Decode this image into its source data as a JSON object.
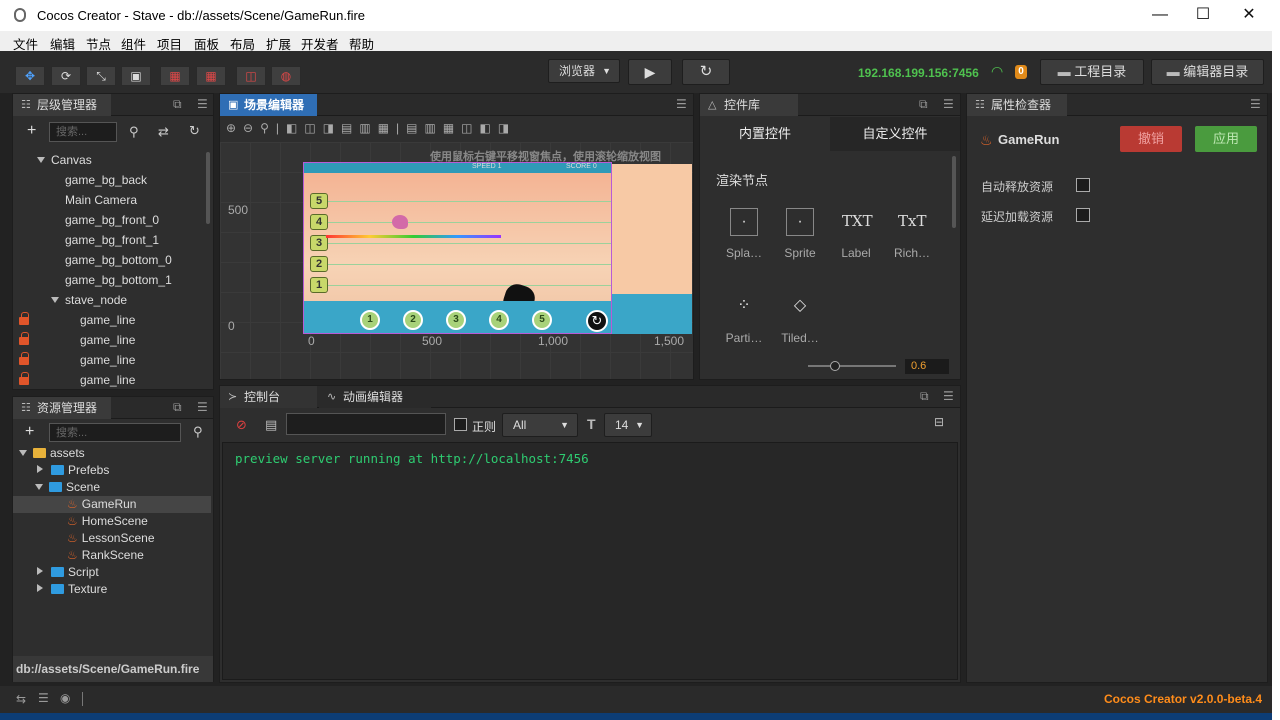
{
  "window": {
    "title": "Cocos Creator - Stave - db://assets/Scene/GameRun.fire",
    "minimize": "—",
    "maximize": "☐",
    "close": "✕"
  },
  "menu": [
    "文件",
    "编辑",
    "节点",
    "组件",
    "项目",
    "面板",
    "布局",
    "扩展",
    "开发者",
    "帮助"
  ],
  "toolbar": {
    "browser_select": "浏览器",
    "play_icon": "▶",
    "refresh_icon": "↻",
    "ip": "192.168.199.156:7456",
    "wifi_badge": "0",
    "project_dir": "工程目录",
    "editor_dir": "编辑器目录"
  },
  "hierarchy": {
    "title": "层级管理器",
    "search_placeholder": "搜索...",
    "items": [
      {
        "label": "Canvas",
        "depth": 0,
        "expanded": true,
        "lock": false
      },
      {
        "label": "game_bg_back",
        "depth": 1,
        "lock": false
      },
      {
        "label": "Main Camera",
        "depth": 1,
        "lock": false
      },
      {
        "label": "game_bg_front_0",
        "depth": 1,
        "lock": false
      },
      {
        "label": "game_bg_front_1",
        "depth": 1,
        "lock": false
      },
      {
        "label": "game_bg_bottom_0",
        "depth": 1,
        "lock": false
      },
      {
        "label": "game_bg_bottom_1",
        "depth": 1,
        "lock": false
      },
      {
        "label": "stave_node",
        "depth": 1,
        "expanded": true,
        "lock": false
      },
      {
        "label": "game_line",
        "depth": 2,
        "lock": true
      },
      {
        "label": "game_line",
        "depth": 2,
        "lock": true
      },
      {
        "label": "game_line",
        "depth": 2,
        "lock": true
      },
      {
        "label": "game_line",
        "depth": 2,
        "lock": true
      }
    ]
  },
  "assets": {
    "title": "资源管理器",
    "search_placeholder": "搜索...",
    "items": [
      {
        "label": "assets",
        "depth": 0,
        "type": "root",
        "expanded": true
      },
      {
        "label": "Prefebs",
        "depth": 1,
        "type": "folder",
        "expanded": false
      },
      {
        "label": "Scene",
        "depth": 1,
        "type": "folder",
        "expanded": true
      },
      {
        "label": "GameRun",
        "depth": 2,
        "type": "fire",
        "selected": true
      },
      {
        "label": "HomeScene",
        "depth": 2,
        "type": "fire"
      },
      {
        "label": "LessonScene",
        "depth": 2,
        "type": "fire"
      },
      {
        "label": "RankScene",
        "depth": 2,
        "type": "fire"
      },
      {
        "label": "Script",
        "depth": 1,
        "type": "folder",
        "expanded": false
      },
      {
        "label": "Texture",
        "depth": 1,
        "type": "folder",
        "expanded": false
      }
    ],
    "path": "db://assets/Scene/GameRun.fire"
  },
  "scene": {
    "title": "场景编辑器",
    "hint": "使用鼠标右键平移视窗焦点，使用滚轮缩放视图",
    "y_ticks": [
      "500",
      "0"
    ],
    "x_ticks": [
      "0",
      "500",
      "1,000",
      "1,500"
    ],
    "hud_speed": "SPEED 1",
    "hud_score": "SCORE 0",
    "lanes": [
      "5",
      "4",
      "3",
      "2",
      "1"
    ],
    "notes": [
      "1",
      "2",
      "3",
      "4",
      "5"
    ]
  },
  "widgets": {
    "title": "控件库",
    "tab_builtin": "内置控件",
    "tab_custom": "自定义控件",
    "section": "渲染节点",
    "items": [
      {
        "label": "Spla…",
        "icon": "sprite-splash-icon"
      },
      {
        "label": "Sprite",
        "icon": "sprite-icon"
      },
      {
        "label": "Label",
        "icon": "label-icon",
        "glyph": "TXT"
      },
      {
        "label": "Rich…",
        "icon": "richtext-icon",
        "glyph": "TxT"
      },
      {
        "label": "Parti…",
        "icon": "particle-icon"
      },
      {
        "label": "Tiled…",
        "icon": "tiledmap-icon"
      }
    ],
    "zoom_value": "0.6",
    "zoom_level": 0.3
  },
  "inspector": {
    "title": "属性检查器",
    "node_name": "GameRun",
    "revert": "撤销",
    "apply": "应用",
    "auto_release": "自动释放资源",
    "delay_load": "延迟加载资源"
  },
  "console": {
    "tab_console": "控制台",
    "tab_anim": "动画编辑器",
    "regex_label": "正则",
    "level": "All",
    "font_size": "14",
    "log": "preview server running at http://localhost:7456"
  },
  "status": {
    "version": "Cocos Creator v2.0.0-beta.4"
  },
  "colors": {
    "accent": "#2f6eb5",
    "ip": "#4fc24f",
    "version": "#ff8c1a",
    "log": "#2ecc71",
    "revert": "#c0392b",
    "apply": "#4caf50"
  }
}
